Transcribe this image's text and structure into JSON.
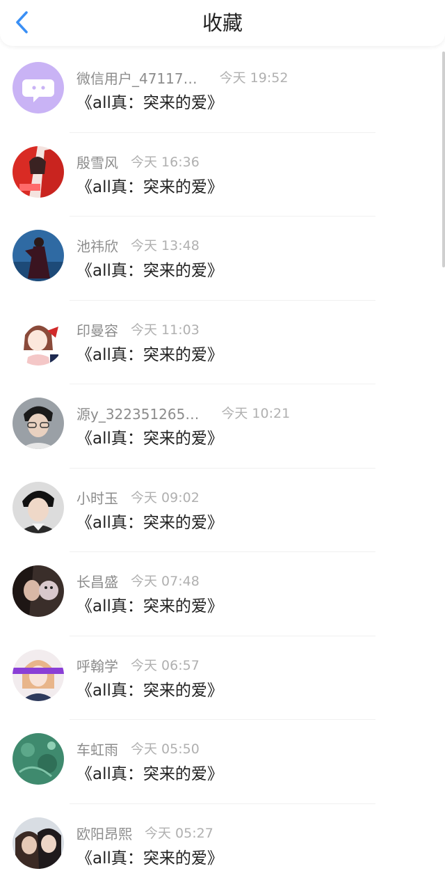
{
  "header": {
    "title": "收藏"
  },
  "colors": {
    "accent": "#3a8ff5",
    "avatar_purple": "#c9b3f5"
  },
  "items": [
    {
      "name": "微信用户_47117…",
      "time": "今天 19:52",
      "title": "《all真：突来的爱》"
    },
    {
      "name": "殷雪风",
      "time": "今天 16:36",
      "title": "《all真：突来的爱》"
    },
    {
      "name": "池祎欣",
      "time": "今天 13:48",
      "title": "《all真：突来的爱》"
    },
    {
      "name": "印曼容",
      "time": "今天 11:03",
      "title": "《all真：突来的爱》"
    },
    {
      "name": "源y_322351265…",
      "time": "今天 10:21",
      "title": "《all真：突来的爱》"
    },
    {
      "name": "小时玉",
      "time": "今天 09:02",
      "title": "《all真：突来的爱》"
    },
    {
      "name": "长昌盛",
      "time": "今天 07:48",
      "title": "《all真：突来的爱》"
    },
    {
      "name": "呼翰学",
      "time": "今天 06:57",
      "title": "《all真：突来的爱》"
    },
    {
      "name": "车虹雨",
      "time": "今天 05:50",
      "title": "《all真：突来的爱》"
    },
    {
      "name": "欧阳昂熙",
      "time": "今天 05:27",
      "title": "《all真：突来的爱》"
    }
  ]
}
